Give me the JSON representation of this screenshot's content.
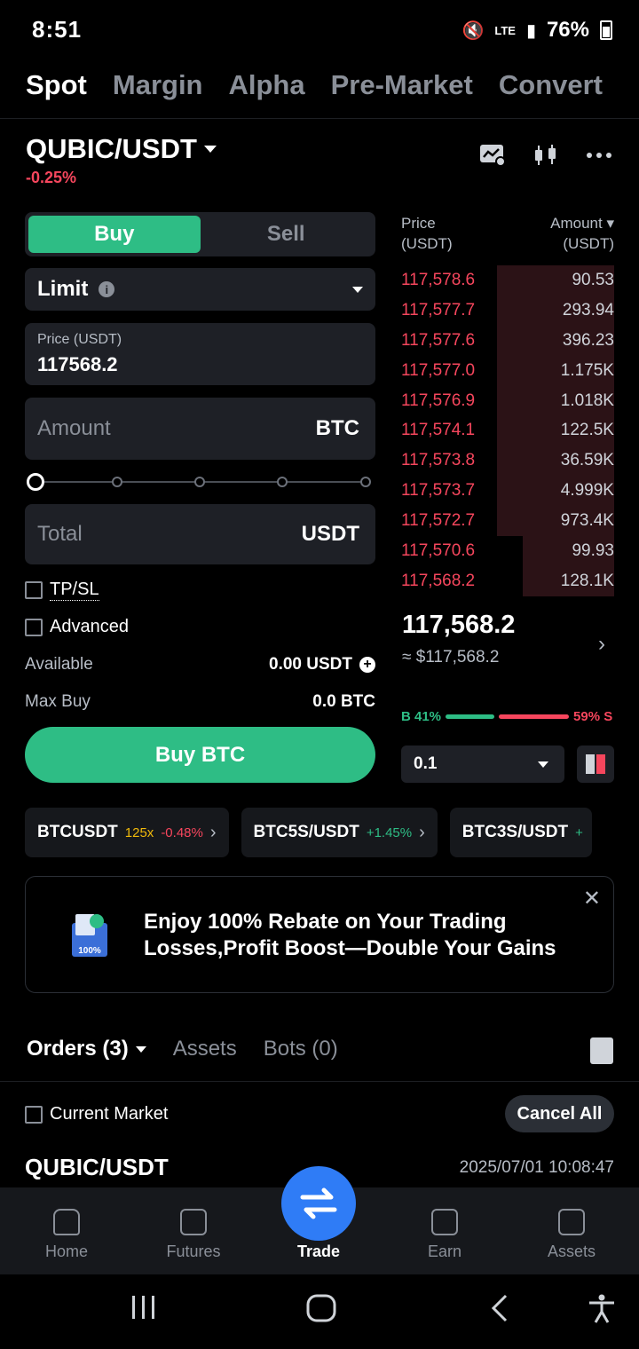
{
  "status": {
    "time": "8:51",
    "network": "LTE",
    "battery": "76%"
  },
  "top_tabs": [
    {
      "label": "Spot",
      "active": true
    },
    {
      "label": "Margin",
      "active": false
    },
    {
      "label": "Alpha",
      "active": false
    },
    {
      "label": "Pre-Market",
      "active": false
    },
    {
      "label": "Convert",
      "active": false
    }
  ],
  "pair": {
    "symbol": "QUBIC/USDT",
    "change": "-0.25%"
  },
  "trade_form": {
    "buy_label": "Buy",
    "sell_label": "Sell",
    "order_type": "Limit",
    "price_label": "Price (USDT)",
    "price_value": "117568.2",
    "amount_placeholder": "Amount",
    "amount_unit": "BTC",
    "total_placeholder": "Total",
    "total_unit": "USDT",
    "tpsl_label": "TP/SL",
    "advanced_label": "Advanced",
    "available_label": "Available",
    "available_value": "0.00 USDT",
    "maxbuy_label": "Max Buy",
    "maxbuy_value": "0.0 BTC",
    "submit_label": "Buy BTC"
  },
  "order_book": {
    "price_header": "Price",
    "price_unit": "(USDT)",
    "amount_header": "Amount",
    "amount_unit": "(USDT)",
    "asks": [
      {
        "price": "117,578.6",
        "amount": "90.53",
        "depth": 0.55
      },
      {
        "price": "117,577.7",
        "amount": "293.94",
        "depth": 0.55
      },
      {
        "price": "117,577.6",
        "amount": "396.23",
        "depth": 0.55
      },
      {
        "price": "117,577.0",
        "amount": "1.175K",
        "depth": 0.55
      },
      {
        "price": "117,576.9",
        "amount": "1.018K",
        "depth": 0.55
      },
      {
        "price": "117,574.1",
        "amount": "122.5K",
        "depth": 0.55
      },
      {
        "price": "117,573.8",
        "amount": "36.59K",
        "depth": 0.55
      },
      {
        "price": "117,573.7",
        "amount": "4.999K",
        "depth": 0.55
      },
      {
        "price": "117,572.7",
        "amount": "973.4K",
        "depth": 0.55
      },
      {
        "price": "117,570.6",
        "amount": "99.93",
        "depth": 0.43
      },
      {
        "price": "117,568.2",
        "amount": "128.1K",
        "depth": 0.43
      }
    ],
    "last_price": "117,568.2",
    "last_price_usd": "≈ $117,568.2",
    "buy_ratio_label": "B 41%",
    "sell_ratio_label": "59% S",
    "buy_ratio": 0.41,
    "precision": "0.1"
  },
  "tickers": [
    {
      "name": "BTCUSDT",
      "leverage": "125x",
      "change": "-0.48%",
      "direction": "down"
    },
    {
      "name": "BTC5S/USDT",
      "leverage": "",
      "change": "+1.45%",
      "direction": "up"
    },
    {
      "name": "BTC3S/USDT",
      "leverage": "",
      "change": "+",
      "direction": "up"
    }
  ],
  "promo": {
    "line1": "Enjoy 100% Rebate on Your Trading",
    "line2": "Losses,Profit Boost—Double Your Gains",
    "badge_text": "100%"
  },
  "orders": {
    "tabs": [
      "Orders (3)",
      "Assets",
      "Bots (0)"
    ],
    "current_market_label": "Current Market",
    "cancel_all_label": "Cancel All",
    "first_pair": "QUBIC/USDT",
    "first_time": "2025/07/01 10:08:47"
  },
  "bottom_nav": [
    "Home",
    "Futures",
    "Trade",
    "Earn",
    "Assets"
  ],
  "colors": {
    "buy": "#2ebd85",
    "sell": "#f6465d",
    "trade_fab": "#2f7cf6"
  }
}
